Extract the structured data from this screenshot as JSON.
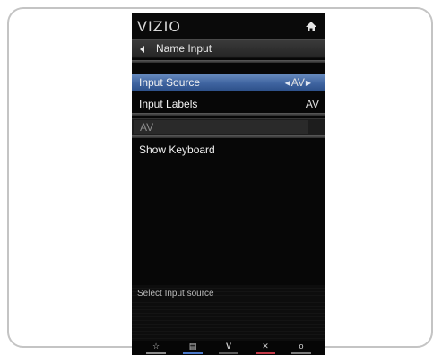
{
  "tv_menu": {
    "logo": "VIZIO",
    "home_icon": "home-icon",
    "back_label": "Name Input",
    "rows": [
      {
        "label": "Input Source",
        "value": "AV",
        "selected": true
      },
      {
        "label": "Input Labels",
        "value": "AV",
        "selected": false
      }
    ],
    "text_field_value": "AV",
    "show_keyboard_label": "Show Keyboard",
    "help_text": "Select Input source",
    "bottom_buttons": [
      {
        "icon": "star-icon",
        "glyph": "☆",
        "color": "#8a8a8a"
      },
      {
        "icon": "widget-icon",
        "glyph": "▤",
        "color": "#4a78c8"
      },
      {
        "icon": "v-logo-icon",
        "glyph": "V",
        "color": "#5a5a5a"
      },
      {
        "icon": "close-icon",
        "glyph": "✕",
        "color": "#c23a48"
      },
      {
        "icon": "power-icon",
        "glyph": "o",
        "color": "#7a7a7a"
      }
    ]
  },
  "colors": {
    "selected_row": "#3f64a0",
    "panel_background": "#070707"
  }
}
